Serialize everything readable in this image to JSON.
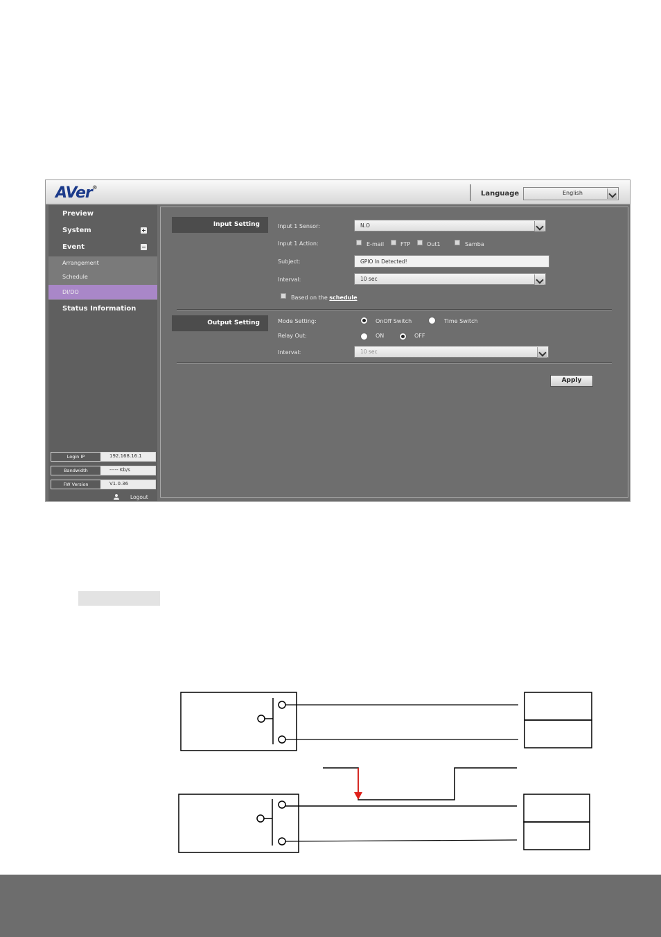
{
  "header": {
    "logo": "AVer",
    "language_label": "Language",
    "language_value": "English"
  },
  "sidebar": {
    "items": [
      {
        "label": "Preview"
      },
      {
        "label": "System"
      },
      {
        "label": "Event"
      },
      {
        "label": "Status Information"
      }
    ],
    "sub_items": [
      {
        "label": "Arrangement"
      },
      {
        "label": "Schedule"
      },
      {
        "label": "DI/DO"
      }
    ],
    "info": {
      "login_ip_label": "Login IP",
      "login_ip_value": "192.168.16.1",
      "bandwidth_label": "Bandwidth",
      "bandwidth_value": "----- Kb/s",
      "fw_label": "FW Version",
      "fw_value": "V1.0.36"
    },
    "logout_label": "Logout"
  },
  "input_setting": {
    "title": "Input Setting",
    "sensor_label": "Input 1 Sensor:",
    "sensor_value": "N.O",
    "action_label": "Input 1 Action:",
    "actions": [
      "E-mail",
      "FTP",
      "Out1",
      "Samba"
    ],
    "subject_label": "Subject:",
    "subject_value": "GPIO In Detected!",
    "interval_label": "Interval:",
    "interval_value": "10 sec",
    "schedule_text": "Based on the",
    "schedule_link": "schedule"
  },
  "output_setting": {
    "title": "Output Setting",
    "mode_label": "Mode Setting:",
    "mode_options": [
      "OnOff Switch",
      "Time Switch"
    ],
    "mode_selected": "OnOff Switch",
    "relay_label": "Relay Out:",
    "relay_options": [
      "ON",
      "OFF"
    ],
    "relay_selected": "OFF",
    "interval_label": "Interval:",
    "interval_value": "10 sec"
  },
  "apply_label": "Apply",
  "colors": {
    "accent_active": "#a987c8",
    "arrow": "#e0201a"
  }
}
